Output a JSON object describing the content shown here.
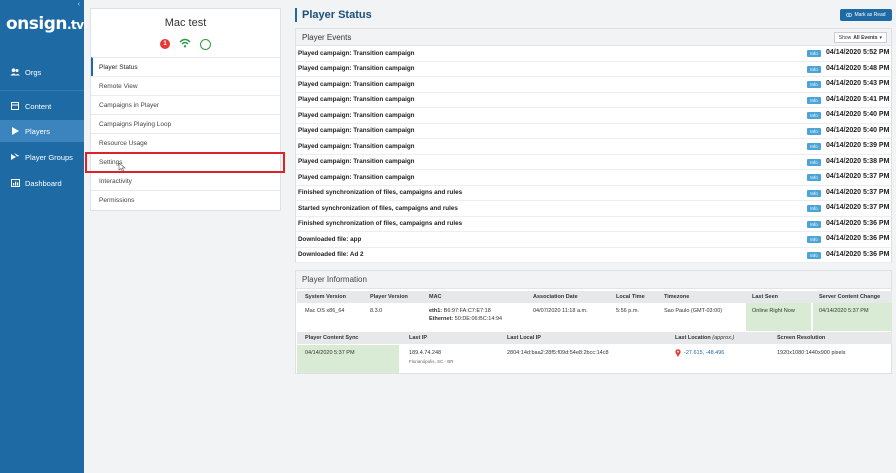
{
  "sidebar": {
    "logo_main": "onsign",
    "logo_suffix": ".tv",
    "collapse_glyph": "‹",
    "items": [
      {
        "label": "Orgs",
        "icon": "users-icon"
      },
      {
        "label": "Content",
        "icon": "content-icon"
      },
      {
        "label": "Players",
        "icon": "play-icon"
      },
      {
        "label": "Player Groups",
        "icon": "player-groups-icon"
      },
      {
        "label": "Dashboard",
        "icon": "dashboard-icon"
      }
    ],
    "active": "Players",
    "accent_color": "#1d6aa5"
  },
  "player": {
    "name": "Mac test",
    "alert_count": "1",
    "menu": [
      "Player Status",
      "Remote View",
      "Campaigns in Player",
      "Campaigns Playing Loop",
      "Resource Usage",
      "Settings",
      "Interactivity",
      "Permissions"
    ],
    "active_item": "Player Status",
    "highlighted_item": "Settings"
  },
  "main": {
    "title": "Player Status",
    "mark_read_label": "Mark as Read"
  },
  "events": {
    "title": "Player Events",
    "filter_prefix": "Show",
    "filter_value": "All Events",
    "rows": [
      {
        "text": "Played campaign: Transition campaign",
        "tag": "Info",
        "date": "04/14/2020 5:52 PM"
      },
      {
        "text": "Played campaign: Transition campaign",
        "tag": "Info",
        "date": "04/14/2020 5:48 PM"
      },
      {
        "text": "Played campaign: Transition campaign",
        "tag": "Info",
        "date": "04/14/2020 5:43 PM"
      },
      {
        "text": "Played campaign: Transition campaign",
        "tag": "Info",
        "date": "04/14/2020 5:41 PM"
      },
      {
        "text": "Played campaign: Transition campaign",
        "tag": "Info",
        "date": "04/14/2020 5:40 PM"
      },
      {
        "text": "Played campaign: Transition campaign",
        "tag": "Info",
        "date": "04/14/2020 5:40 PM"
      },
      {
        "text": "Played campaign: Transition campaign",
        "tag": "Info",
        "date": "04/14/2020 5:39 PM"
      },
      {
        "text": "Played campaign: Transition campaign",
        "tag": "Info",
        "date": "04/14/2020 5:38 PM"
      },
      {
        "text": "Played campaign: Transition campaign",
        "tag": "Info",
        "date": "04/14/2020 5:37 PM"
      },
      {
        "text": "Finished synchronization of files, campaigns and rules",
        "tag": "Info",
        "date": "04/14/2020 5:37 PM"
      },
      {
        "text": "Started synchronization of files, campaigns and rules",
        "tag": "Info",
        "date": "04/14/2020 5:37 PM"
      },
      {
        "text": "Finished synchronization of files, campaigns and rules",
        "tag": "Info",
        "date": "04/14/2020 5:36 PM"
      },
      {
        "text": "Downloaded file: app",
        "tag": "Info",
        "date": "04/14/2020 5:36 PM"
      },
      {
        "text": "Downloaded file: Ad 2",
        "tag": "Info",
        "date": "04/14/2020 5:36 PM"
      }
    ]
  },
  "info": {
    "title": "Player Information",
    "headers1": [
      "System Version",
      "Player Version",
      "MAC",
      "Association Date",
      "Local Time",
      "Timezone",
      "Last Seen",
      "Server Content Change"
    ],
    "row1": {
      "system_version": "Mac OS x86_64",
      "player_version": "8.3.0",
      "mac_label1": "eth1:",
      "mac_value1": "B6:97:FA:C7:E7:18",
      "mac_label2": "Ethernet:",
      "mac_value2": "50:DE:06:BC:14:94",
      "association_date": "04/07/2020 11:18 a.m.",
      "local_time": "5:56 p.m.",
      "timezone": "Sao Paulo (GMT-03:00)",
      "last_seen": "Online Right Now",
      "server_content_change": "04/14/2020 5:37 PM"
    },
    "headers2": [
      "Player Content Sync",
      "Last IP",
      "Last Local IP",
      "Last Location",
      "(approx.)",
      "Screen Resolution"
    ],
    "row2": {
      "content_sync": "04/14/2020 5:37 PM",
      "last_ip": "189.4.74.248",
      "last_ip_location": "Florianópolis, SC - BR",
      "last_local_ip": "2804:14d:baa2:28f5:f09d:54e8:2bcc:14c8",
      "last_location": "-27.615, -48.496",
      "screen_resolution": "1920x1080:1440x900 pixels"
    }
  }
}
